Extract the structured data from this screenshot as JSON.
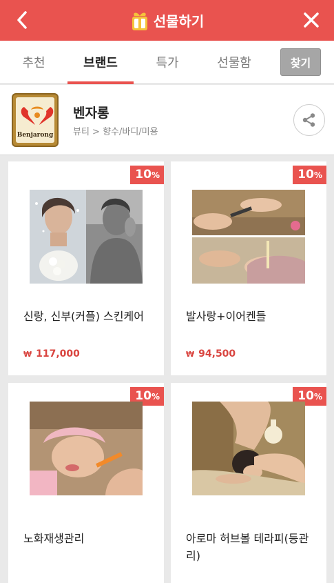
{
  "header": {
    "title": "선물하기"
  },
  "tabs": [
    {
      "label": "추천"
    },
    {
      "label": "브랜드"
    },
    {
      "label": "특가"
    },
    {
      "label": "선물함"
    }
  ],
  "find_button": "찾기",
  "brand": {
    "name": "벤자롱",
    "category": "뷰티 > 향수/바디/미용",
    "logo_text": "Benjarong"
  },
  "products": [
    {
      "name": "신랑, 신부(커플) 스킨케어",
      "price": "117,000",
      "currency": "₩",
      "discount": "10",
      "unit": "%"
    },
    {
      "name": "발사랑+이어켄들",
      "price": "94,500",
      "currency": "₩",
      "discount": "10",
      "unit": "%"
    },
    {
      "name": "노화재생관리",
      "price": "",
      "currency": "",
      "discount": "10",
      "unit": "%"
    },
    {
      "name": "아로마 허브볼 테라피(등관리)",
      "price": "",
      "currency": "",
      "discount": "10",
      "unit": "%"
    }
  ],
  "colors": {
    "accent": "#e9534f",
    "price": "#d9443f",
    "gift_icon": "#f5c33b"
  }
}
